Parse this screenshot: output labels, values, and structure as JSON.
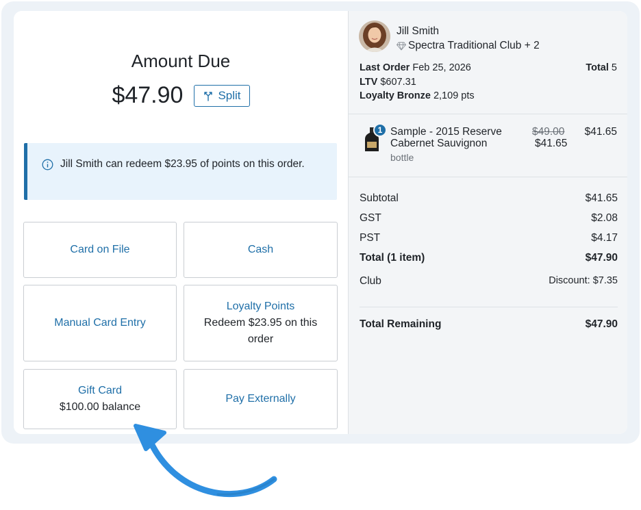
{
  "payment": {
    "title": "Amount Due",
    "amount": "$47.90",
    "split_label": "Split",
    "info_message": "Jill Smith can redeem $23.95 of points on this order.",
    "methods": [
      {
        "label": "Card on File",
        "sub": ""
      },
      {
        "label": "Cash",
        "sub": ""
      },
      {
        "label": "Manual Card Entry",
        "sub": ""
      },
      {
        "label": "Loyalty Points",
        "sub": "Redeem $23.95 on this order"
      },
      {
        "label": "Gift Card",
        "sub": "$100.00 balance"
      },
      {
        "label": "Pay Externally",
        "sub": ""
      }
    ]
  },
  "customer": {
    "name": "Jill Smith",
    "club": "Spectra Traditional Club + 2",
    "last_order_label": "Last Order",
    "last_order_value": "Feb 25, 2026",
    "total_label": "Total",
    "total_value": "5",
    "ltv_label": "LTV",
    "ltv_value": "$607.31",
    "loyalty_label": "Loyalty Bronze",
    "loyalty_value": "2,109 pts"
  },
  "cart": {
    "items": [
      {
        "qty": "1",
        "name": "Sample - 2015 Reserve Cabernet Sauvignon",
        "unit": "bottle",
        "original_price": "$49.00",
        "discounted_price": "$41.65",
        "line_total": "$41.65"
      }
    ]
  },
  "summary": {
    "subtotal_label": "Subtotal",
    "subtotal_value": "$41.65",
    "gst_label": "GST",
    "gst_value": "$2.08",
    "pst_label": "PST",
    "pst_value": "$4.17",
    "total_label": "Total (1 item)",
    "total_value": "$47.90",
    "club_label": "Club",
    "club_value": "Discount: $7.35",
    "remaining_label": "Total Remaining",
    "remaining_value": "$47.90"
  },
  "colors": {
    "accent": "#1f6fa8",
    "info_bg": "#e8f3fc",
    "arrow": "#2f8fe0",
    "badge": "#1f6fa8"
  },
  "icons": [
    "split-icon",
    "info-icon",
    "diamond-icon",
    "bottle-icon",
    "curved-arrow-icon"
  ]
}
